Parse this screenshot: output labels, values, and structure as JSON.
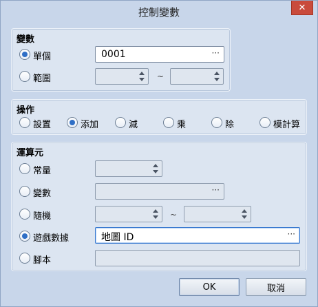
{
  "window": {
    "title": "控制變數",
    "close_glyph": "✕"
  },
  "variable_group": {
    "title": "變數",
    "single": {
      "label": "單個",
      "checked": true,
      "value": "0001"
    },
    "range": {
      "label": "範圍",
      "checked": false,
      "tilde": "~"
    }
  },
  "operation_group": {
    "title": "操作",
    "options": [
      {
        "label": "設置",
        "checked": false
      },
      {
        "label": "添加",
        "checked": true
      },
      {
        "label": "減",
        "checked": false
      },
      {
        "label": "乘",
        "checked": false
      },
      {
        "label": "除",
        "checked": false
      },
      {
        "label": "模計算",
        "checked": false
      }
    ]
  },
  "operand_group": {
    "title": "運算元",
    "constant": {
      "label": "常量",
      "checked": false
    },
    "variable": {
      "label": "變數",
      "checked": false
    },
    "random": {
      "label": "隨機",
      "checked": false,
      "tilde": "~"
    },
    "game_data": {
      "label": "遊戲數據",
      "checked": true,
      "value": "地圖 ID"
    },
    "script": {
      "label": "腳本",
      "checked": false
    }
  },
  "buttons": {
    "ok": "OK",
    "cancel": "取消"
  },
  "dots_glyph": "···",
  "colors": {
    "accent": "#2f6fc6",
    "close": "#c94b3c",
    "window_bg": "#c8d6ea",
    "group_bg": "#dce5f1"
  }
}
